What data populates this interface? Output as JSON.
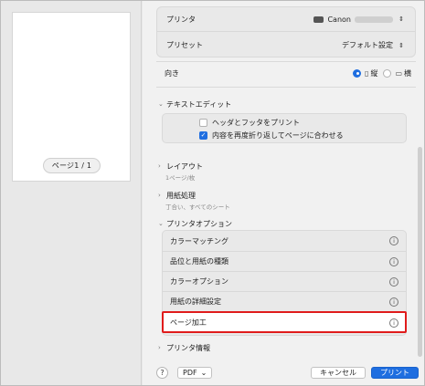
{
  "preview": {
    "page_indicator": "ページ1 / 1"
  },
  "printer": {
    "label": "プリンタ",
    "value": "Canon"
  },
  "preset": {
    "label": "プリセット",
    "value": "デフォルト設定"
  },
  "orientation": {
    "label": "向き",
    "portrait": "縦",
    "landscape": "横",
    "selected": "縦"
  },
  "text_edit": {
    "title": "テキストエディット",
    "options": [
      {
        "label": "ヘッダとフッタをプリント",
        "checked": false
      },
      {
        "label": "内容を再度折り返してページに合わせる",
        "checked": true
      }
    ]
  },
  "layout": {
    "title": "レイアウト",
    "summary": "1ページ/枚"
  },
  "paper_handling": {
    "title": "用紙処理",
    "summary": "丁合い、すべてのシート"
  },
  "printer_options": {
    "title": "プリンタオプション",
    "items": [
      {
        "label": "カラーマッチング"
      },
      {
        "label": "品位と用紙の種類"
      },
      {
        "label": "カラーオプション"
      },
      {
        "label": "用紙の詳細設定"
      },
      {
        "label": "ページ加工"
      }
    ],
    "selected_item": "ページ加工"
  },
  "printer_info": {
    "title": "プリンタ情報"
  },
  "footer": {
    "help": "?",
    "pdf": "PDF",
    "cancel": "キャンセル",
    "print": "プリント"
  },
  "colors": {
    "accent": "#1f6ee0",
    "highlight_border": "#e01b1b"
  }
}
